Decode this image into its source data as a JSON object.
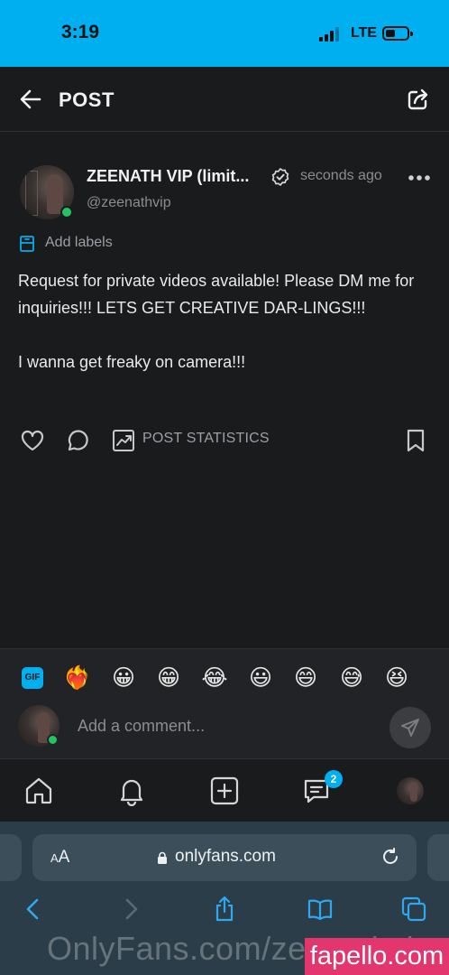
{
  "status_bar": {
    "time": "3:19",
    "network": "LTE",
    "bg_color": "#00aff0"
  },
  "header": {
    "title": "POST"
  },
  "post": {
    "display_name": "ZEENATH VIP (limit...",
    "username": "@zeenathvip",
    "time": "seconds ago",
    "labels_text": "Add labels",
    "text_lines": [
      "Request for private videos available! Please DM me for inquiries!!! LETS GET CREATIVE DAR-LINGS!!!",
      "I wanna get freaky on camera!!!"
    ],
    "stats_label": "POST STATISTICS",
    "online_color": "#21c460"
  },
  "composer": {
    "gif_label": "GIF",
    "emojis": [
      "❤️‍🔥",
      "😀",
      "😁",
      "😂",
      "😃",
      "😄",
      "😅",
      "😆"
    ],
    "placeholder": "Add a comment..."
  },
  "bottom_nav": {
    "messages_badge": "2",
    "accent": "#00aff0"
  },
  "browser": {
    "aa_label": "AA",
    "url": "onlyfans.com"
  },
  "watermarks": {
    "site_text": "OnlyFans.com/zeenathvip",
    "badge": "fapello.com"
  }
}
